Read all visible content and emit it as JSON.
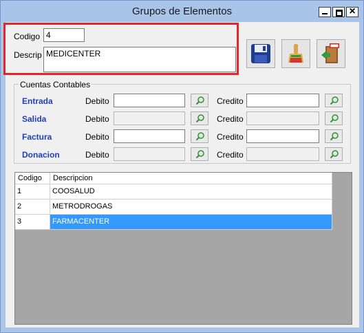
{
  "window": {
    "title": "Grupos de Elementos"
  },
  "form": {
    "codigo_label": "Codigo",
    "codigo_value": "4",
    "descrip_label": "Descrip",
    "descrip_value": "MEDICENTER"
  },
  "toolbar": {
    "save": "save-icon",
    "clean": "broom-icon",
    "exit": "exit-door-icon"
  },
  "cuentas": {
    "group_title": "Cuentas Contables",
    "debito_label": "Debito",
    "credito_label": "Credito",
    "rows": [
      {
        "label": "Entrada"
      },
      {
        "label": "Salida"
      },
      {
        "label": "Factura"
      },
      {
        "label": "Donacion"
      }
    ]
  },
  "grid": {
    "columns": [
      "Codigo",
      "Descripcion"
    ],
    "rows": [
      {
        "codigo": "1",
        "descripcion": "COOSALUD"
      },
      {
        "codigo": "2",
        "descripcion": "METRODROGAS"
      },
      {
        "codigo": "3",
        "descripcion": "FARMACENTER"
      }
    ],
    "selected_index": 2
  },
  "colors": {
    "accent": "#3399ff",
    "highlight_box": "#e3262e",
    "row_label": "#1f3fb6"
  }
}
